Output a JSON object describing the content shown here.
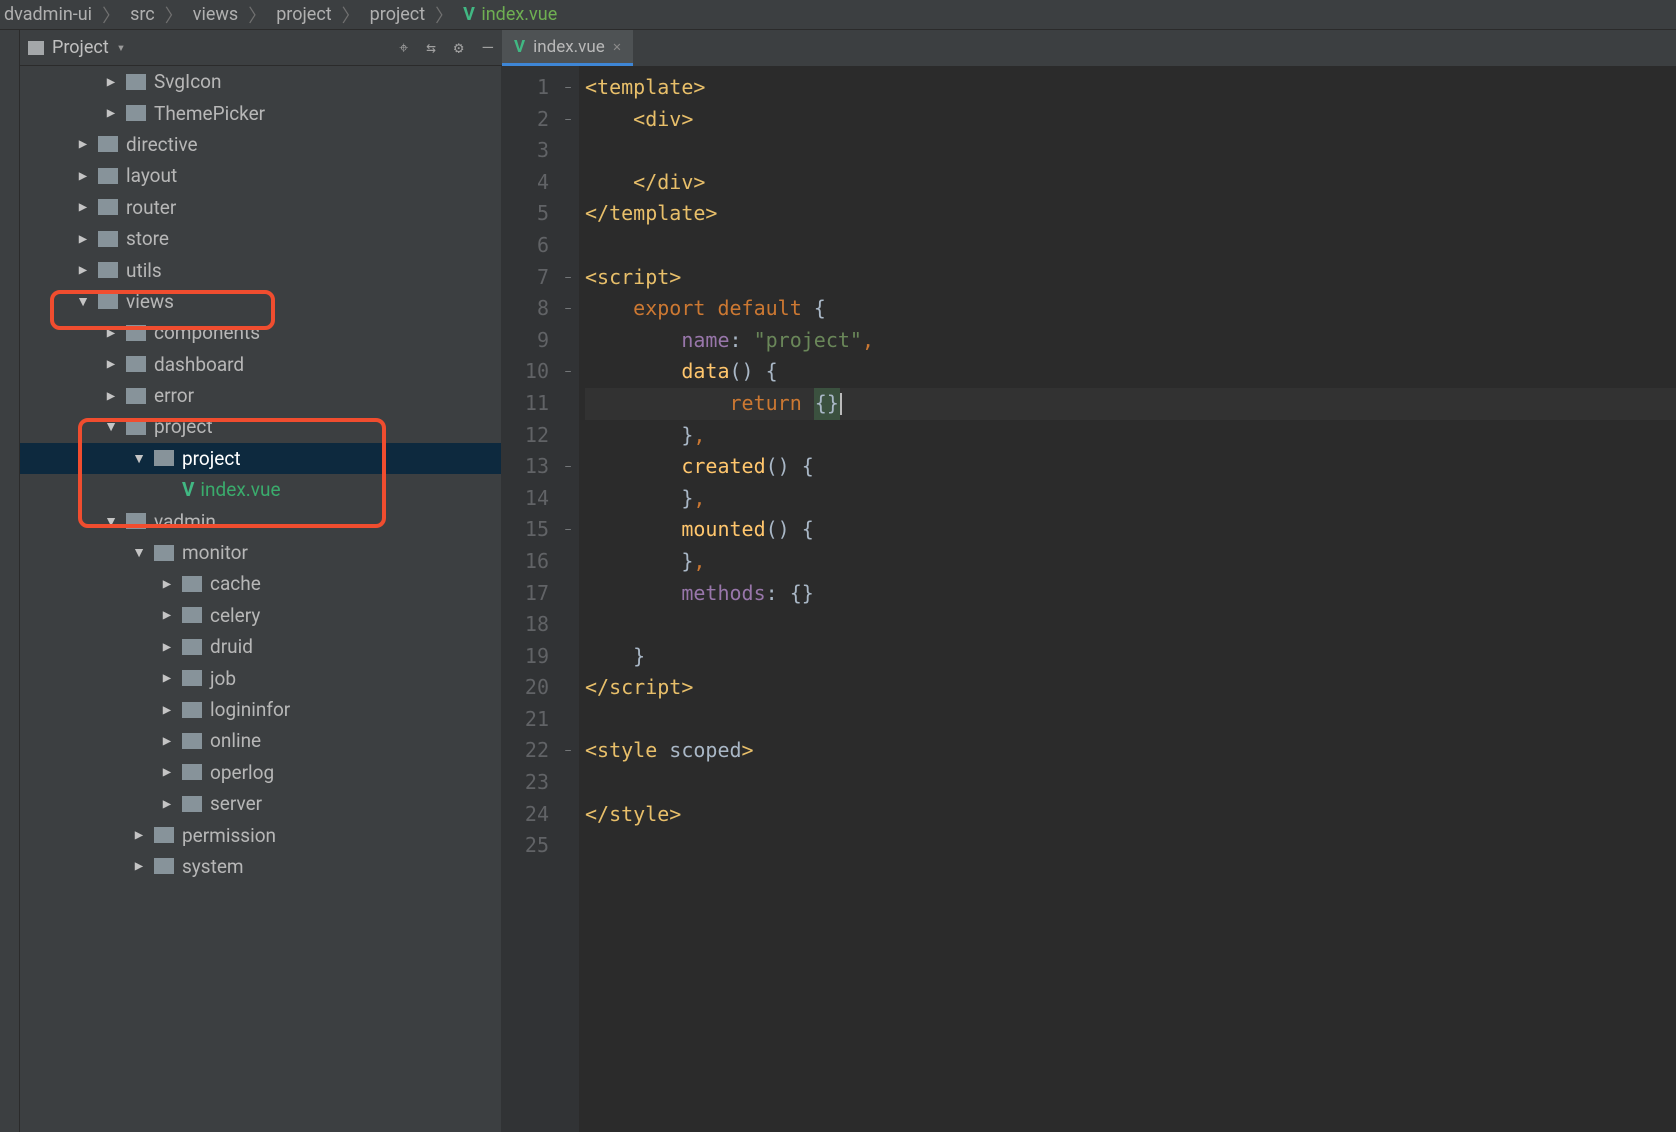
{
  "breadcrumbs": [
    "dvadmin-ui",
    "src",
    "views",
    "project",
    "project"
  ],
  "breadcrumb_file": "index.vue",
  "sidebar": {
    "title": "Project"
  },
  "tree": [
    {
      "depth": 3,
      "arrow": "right",
      "kind": "folder",
      "label": "SvgIcon"
    },
    {
      "depth": 3,
      "arrow": "right",
      "kind": "folder",
      "label": "ThemePicker"
    },
    {
      "depth": 2,
      "arrow": "right",
      "kind": "folder",
      "label": "directive"
    },
    {
      "depth": 2,
      "arrow": "right",
      "kind": "folder",
      "label": "layout"
    },
    {
      "depth": 2,
      "arrow": "right",
      "kind": "folder",
      "label": "router"
    },
    {
      "depth": 2,
      "arrow": "right",
      "kind": "folder",
      "label": "store"
    },
    {
      "depth": 2,
      "arrow": "right",
      "kind": "folder",
      "label": "utils"
    },
    {
      "depth": 2,
      "arrow": "down",
      "kind": "folder",
      "label": "views"
    },
    {
      "depth": 3,
      "arrow": "right",
      "kind": "folder",
      "label": "components"
    },
    {
      "depth": 3,
      "arrow": "right",
      "kind": "folder",
      "label": "dashboard"
    },
    {
      "depth": 3,
      "arrow": "right",
      "kind": "folder",
      "label": "error"
    },
    {
      "depth": 3,
      "arrow": "down",
      "kind": "folder",
      "label": "project"
    },
    {
      "depth": 4,
      "arrow": "down",
      "kind": "folder",
      "label": "project",
      "selected": true
    },
    {
      "depth": 5,
      "arrow": "none",
      "kind": "vue",
      "label": "index.vue"
    },
    {
      "depth": 3,
      "arrow": "down",
      "kind": "folder",
      "label": "vadmin"
    },
    {
      "depth": 4,
      "arrow": "down",
      "kind": "folder",
      "label": "monitor"
    },
    {
      "depth": 5,
      "arrow": "right",
      "kind": "folder",
      "label": "cache"
    },
    {
      "depth": 5,
      "arrow": "right",
      "kind": "folder",
      "label": "celery"
    },
    {
      "depth": 5,
      "arrow": "right",
      "kind": "folder",
      "label": "druid"
    },
    {
      "depth": 5,
      "arrow": "right",
      "kind": "folder",
      "label": "job"
    },
    {
      "depth": 5,
      "arrow": "right",
      "kind": "folder",
      "label": "logininfor"
    },
    {
      "depth": 5,
      "arrow": "right",
      "kind": "folder",
      "label": "online"
    },
    {
      "depth": 5,
      "arrow": "right",
      "kind": "folder",
      "label": "operlog"
    },
    {
      "depth": 5,
      "arrow": "right",
      "kind": "folder",
      "label": "server"
    },
    {
      "depth": 4,
      "arrow": "right",
      "kind": "folder",
      "label": "permission"
    },
    {
      "depth": 4,
      "arrow": "right",
      "kind": "folder",
      "label": "system"
    }
  ],
  "tab": {
    "label": "index.vue"
  },
  "code": {
    "lines": [
      {
        "n": 1,
        "fold": "−",
        "html": "<span class='yel'>&lt;template&gt;</span>"
      },
      {
        "n": 2,
        "fold": "−",
        "html": "    <span class='yel'>&lt;div&gt;</span>"
      },
      {
        "n": 3,
        "fold": "",
        "html": ""
      },
      {
        "n": 4,
        "fold": "",
        "html": "    <span class='yel'>&lt;/div&gt;</span>"
      },
      {
        "n": 5,
        "fold": "",
        "html": "<span class='yel'>&lt;/template&gt;</span>"
      },
      {
        "n": 6,
        "fold": "",
        "html": ""
      },
      {
        "n": 7,
        "fold": "−",
        "html": "<span class='yel'>&lt;script&gt;</span>"
      },
      {
        "n": 8,
        "fold": "−",
        "html": "    <span class='ora'>export default</span> <span class='wht'>{</span>"
      },
      {
        "n": 9,
        "fold": "",
        "html": "        <span class='pur'>name</span><span class='wht'>:</span> <span class='grn'>\"project\"</span><span class='ora'>,</span>"
      },
      {
        "n": 10,
        "fold": "−",
        "html": "        <span class='yel2'>data</span><span class='wht'>() {</span>"
      },
      {
        "n": 11,
        "fold": "",
        "html": "            <span class='ora'>return</span> <span class='caret-box'><span class='wht'>{}</span></span><span class='caret'></span>",
        "current": true
      },
      {
        "n": 12,
        "fold": "",
        "html": "        <span class='wht'>}</span><span class='ora'>,</span>"
      },
      {
        "n": 13,
        "fold": "−",
        "html": "        <span class='yel2'>created</span><span class='wht'>() {</span>"
      },
      {
        "n": 14,
        "fold": "",
        "html": "        <span class='wht'>}</span><span class='ora'>,</span>"
      },
      {
        "n": 15,
        "fold": "−",
        "html": "        <span class='yel2'>mounted</span><span class='wht'>() {</span>"
      },
      {
        "n": 16,
        "fold": "",
        "html": "        <span class='wht'>}</span><span class='ora'>,</span>"
      },
      {
        "n": 17,
        "fold": "",
        "html": "        <span class='pur'>methods</span><span class='wht'>: {}</span>"
      },
      {
        "n": 18,
        "fold": "",
        "html": ""
      },
      {
        "n": 19,
        "fold": "",
        "html": "    <span class='wht'>}</span>"
      },
      {
        "n": 20,
        "fold": "",
        "html": "<span class='yel'>&lt;/script&gt;</span>"
      },
      {
        "n": 21,
        "fold": "",
        "html": ""
      },
      {
        "n": 22,
        "fold": "−",
        "html": "<span class='yel'>&lt;style </span><span class='wht'>scoped</span><span class='yel'>&gt;</span>"
      },
      {
        "n": 23,
        "fold": "",
        "html": ""
      },
      {
        "n": 24,
        "fold": "",
        "html": "<span class='yel'>&lt;/style&gt;</span>"
      },
      {
        "n": 25,
        "fold": "",
        "html": ""
      }
    ]
  }
}
